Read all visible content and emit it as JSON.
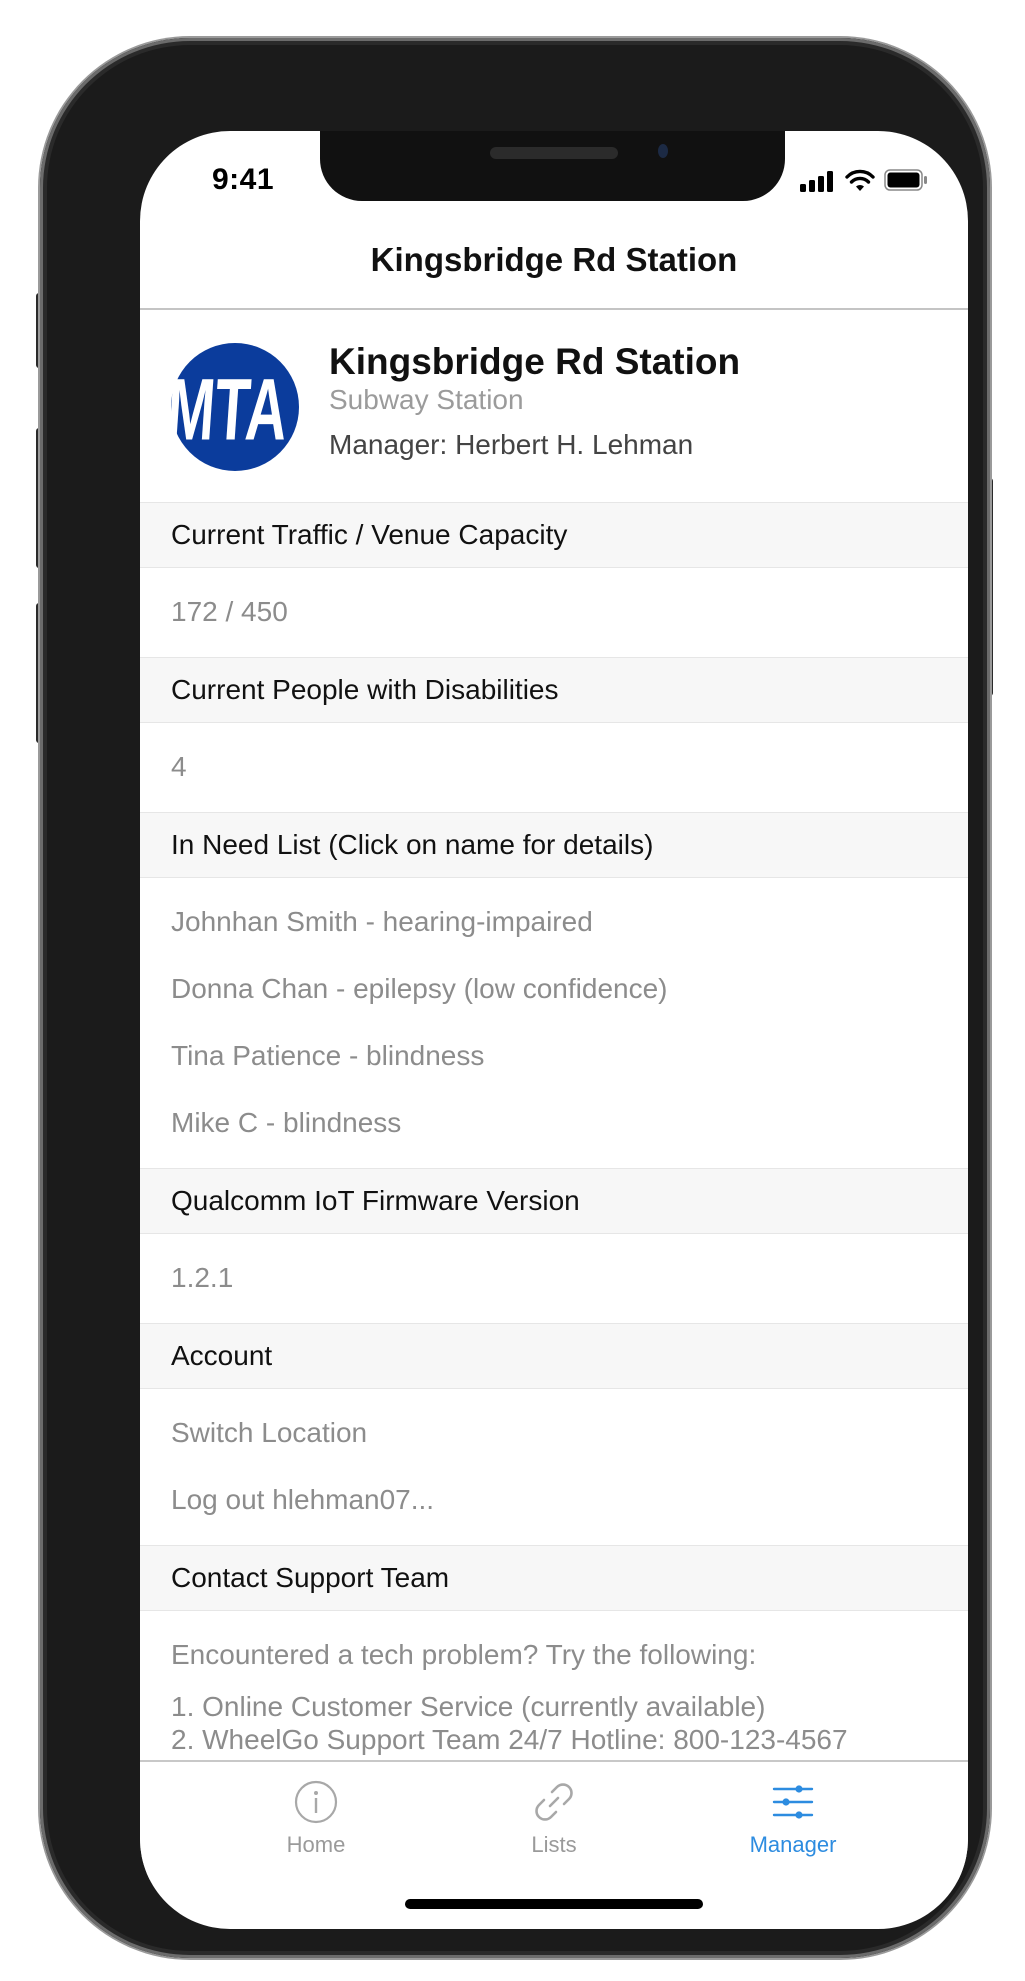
{
  "status_bar": {
    "time": "9:41"
  },
  "nav": {
    "title": "Kingsbridge Rd Station"
  },
  "header": {
    "logo_text": "MTA",
    "title": "Kingsbridge Rd Station",
    "subtitle": "Subway Station",
    "manager": "Manager: Herbert H. Lehman"
  },
  "sections": {
    "traffic": {
      "title": "Current Traffic / Venue Capacity",
      "value": "172 / 450"
    },
    "disabilities": {
      "title": "Current People with Disabilities",
      "value": "4"
    },
    "in_need": {
      "title": "In Need List (Click on name for details)",
      "items": [
        "Johnhan Smith - hearing-impaired",
        "Donna Chan - epilepsy (low confidence)",
        "Tina Patience - blindness",
        "Mike C - blindness"
      ]
    },
    "firmware": {
      "title": "Qualcomm IoT Firmware Version",
      "value": "1.2.1"
    },
    "account": {
      "title": "Account",
      "switch_location": "Switch Location",
      "logout": "Log out hlehman07..."
    },
    "support": {
      "title": "Contact Support Team",
      "intro": "Encountered a tech problem? Try the following:",
      "line1": "1. Online Customer Service (currently available)",
      "line2": "2. WheelGo Support Team 24/7 Hotline: 800-123-4567"
    }
  },
  "tabbar": {
    "home": {
      "label": "Home",
      "icon": "info-circle-icon"
    },
    "lists": {
      "label": "Lists",
      "icon": "link-icon"
    },
    "manager": {
      "label": "Manager",
      "icon": "sliders-icon",
      "active": true
    }
  },
  "colors": {
    "accent": "#2d8ce0",
    "mta_blue": "#0b3c9c",
    "muted_text": "#8c8c8c"
  }
}
